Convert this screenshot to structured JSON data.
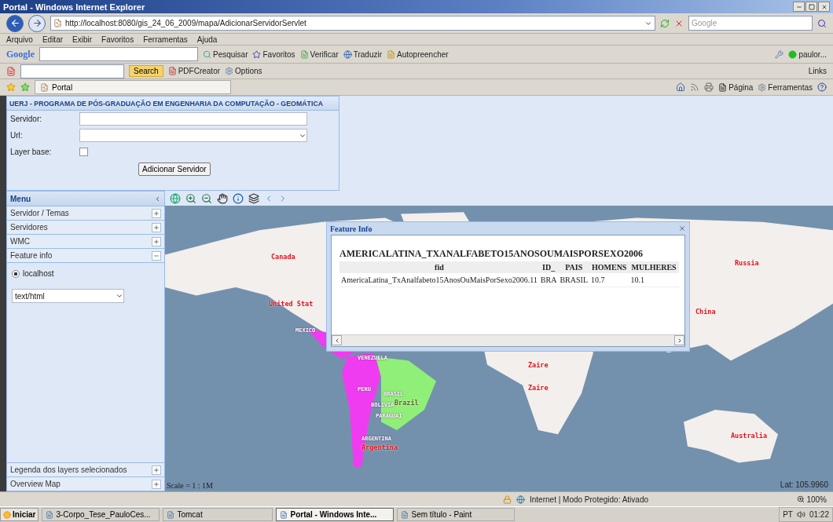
{
  "window": {
    "title": "Portal - Windows Internet Explorer"
  },
  "address_bar": {
    "url": "http://localhost:8080/gis_24_06_2009/mapa/AdicionarServidorServlet",
    "search_placeholder": "Google"
  },
  "menu": [
    "Arquivo",
    "Editar",
    "Exibir",
    "Favoritos",
    "Ferramentas",
    "Ajuda"
  ],
  "google_toolbar": {
    "logo": "Google",
    "items": [
      "Pesquisar",
      "Favoritos",
      "Verificar",
      "Traduzir",
      "Autopreencher"
    ],
    "user": "paulor..."
  },
  "pdf_toolbar": {
    "search_button": "Search",
    "items": [
      "PDFCreator",
      "Options"
    ],
    "links": "Links"
  },
  "tab": {
    "label": "Portal"
  },
  "command_bar": [
    "Página",
    "Ferramentas"
  ],
  "header": {
    "title": "UERJ - PROGRAMA DE PÓS-GRADUAÇÃO EM ENGENHARIA DA COMPUTAÇÃO - GEOMÁTICA",
    "fields": [
      {
        "kind": "text",
        "label": "Servidor:"
      },
      {
        "kind": "select",
        "label": "Url:"
      },
      {
        "kind": "checkbox",
        "label": "Layer base:",
        "checked": false
      }
    ],
    "button": "Adicionar Servidor"
  },
  "sidebar": {
    "title": "Menu",
    "items": [
      {
        "label": "Servidor / Temas",
        "expanded": false
      },
      {
        "label": "Servidores",
        "expanded": false
      },
      {
        "label": "WMC",
        "expanded": false
      },
      {
        "label": "Feature info",
        "expanded": true
      }
    ],
    "feature_info": {
      "servers": [
        {
          "label": "localhost",
          "selected": true
        }
      ],
      "format": "text/html"
    },
    "bottom_items": [
      {
        "label": "Legenda dos layers selecionados",
        "expanded": false
      },
      {
        "label": "Overview Map",
        "expanded": false
      }
    ]
  },
  "map": {
    "scale": "Scale = 1 : 1M",
    "coordinates": "Lat: 105.9960",
    "labels": [
      {
        "text": "Canada",
        "kind": "red"
      },
      {
        "text": "United Stat",
        "kind": "red"
      },
      {
        "text": "MEXICO",
        "kind": "white"
      },
      {
        "text": "VENEZUELA",
        "kind": "white"
      },
      {
        "text": "PERU",
        "kind": "white"
      },
      {
        "text": "BRASIL",
        "kind": "white"
      },
      {
        "text": "Brazil",
        "kind": "dark"
      },
      {
        "text": "BOLIVIA",
        "kind": "white"
      },
      {
        "text": "PARAGUAI",
        "kind": "white"
      },
      {
        "text": "ARGENTINA",
        "kind": "white"
      },
      {
        "text": "Argentina",
        "kind": "red"
      },
      {
        "text": "Zaire",
        "kind": "red"
      },
      {
        "text": "Zaire",
        "kind": "red"
      },
      {
        "text": "China",
        "kind": "red"
      },
      {
        "text": "Russia",
        "kind": "red"
      },
      {
        "text": "Australia",
        "kind": "red"
      }
    ]
  },
  "feature_popup": {
    "title": "Feature Info",
    "layer": "AMERICALATINA_TXANALFABETO15ANOSOUMAISPORSEXO2006",
    "columns": [
      "fid",
      "ID_",
      "PAIS",
      "HOMENS",
      "MULHERES"
    ],
    "rows": [
      [
        "AmericaLatina_TxAnalfabeto15AnosOuMaisPorSexo2006.11",
        "BRA",
        "BRASIL",
        "10.7",
        "10.1"
      ]
    ]
  },
  "status_bar": {
    "zone": "Internet | Modo Protegido: Ativado",
    "zoom": "100%"
  },
  "taskbar": {
    "start": "Iniciar",
    "items": [
      {
        "label": "3-Corpo_Tese_PauloCes...",
        "selected": false
      },
      {
        "label": "Tomcat",
        "selected": false
      },
      {
        "label": "Portal - Windows Inte...",
        "selected": true
      },
      {
        "label": "Sem título - Paint",
        "selected": false
      }
    ],
    "language": "PT",
    "clock": "01:22"
  }
}
